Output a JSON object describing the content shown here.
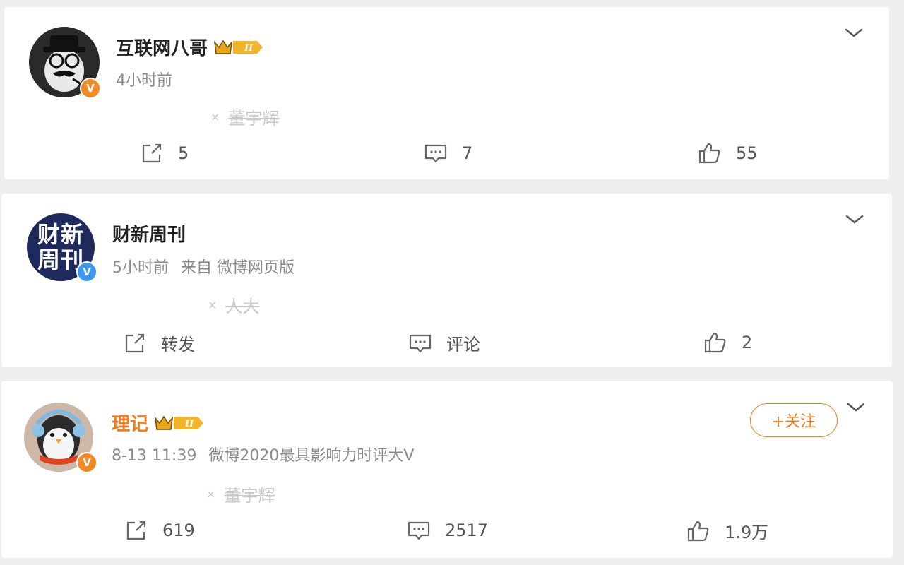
{
  "posts": [
    {
      "author": "互联网八哥",
      "time": "4小时前",
      "source": "",
      "tag": "董宇辉",
      "verified_color": "orange",
      "has_crown": true,
      "crown_level": "II",
      "repost": "5",
      "comment": "7",
      "like": "55"
    },
    {
      "author": "财新周刊",
      "time": "5小时前",
      "source": "来自 微博网页版",
      "tag": "人大",
      "verified_color": "blue",
      "has_crown": false,
      "avatar_text": [
        "财新",
        "周刊"
      ],
      "repost": "转发",
      "comment": "评论",
      "like": "2"
    },
    {
      "author": "理记",
      "time": "8-13 11:39",
      "source": "微博2020最具影响力时评大V",
      "tag": "董宇辉",
      "verified_color": "orange",
      "has_crown": true,
      "crown_level": "II",
      "follow_label": "+关注",
      "repost": "619",
      "comment": "2517",
      "like": "1.9万"
    }
  ],
  "badge_letter": "V",
  "colors": {
    "accent": "#f07d1e",
    "verified_blue": "#3c98f0",
    "verified_orange": "#f08a24",
    "caixin_navy": "#1f2a5c"
  },
  "icons": [
    "repost-icon",
    "comment-icon",
    "like-icon",
    "chevron-down-icon",
    "crown-icon",
    "verified-icon"
  ]
}
